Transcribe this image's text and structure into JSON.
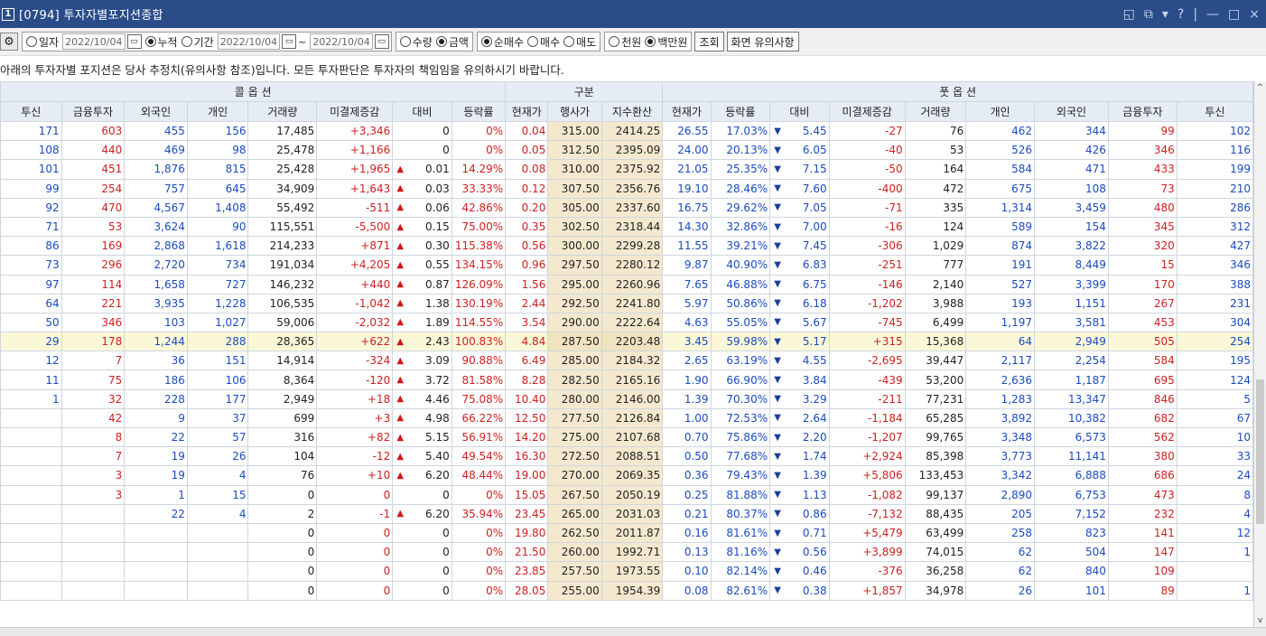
{
  "window": {
    "title_icon": "1",
    "title": "[0794] 투자자별포지션종합",
    "controls": [
      "◱",
      "⧉",
      "▾",
      "?",
      "|",
      "—",
      "□",
      "×"
    ]
  },
  "toolbar": {
    "gear": "⚙",
    "period": {
      "daily": "일자",
      "date1": "2022/10/04",
      "cumulative": "누적",
      "range": "기간",
      "date2": "2022/10/04",
      "tilde": "~",
      "date3": "2022/10/04"
    },
    "unit": {
      "qty": "수량",
      "amount": "금액"
    },
    "trade": {
      "net": "순매수",
      "buy": "매수",
      "sell": "매도"
    },
    "money": {
      "thousand": "천원",
      "million": "백만원"
    },
    "query_button": "조회",
    "notice_button": "화면 유의사항"
  },
  "notice": "아래의 투자자별 포지션은 당사 추정치(유의사항 참조)입니다. 모든 투자판단은 투자자의 책임임을 유의하시기 바랍니다.",
  "header": {
    "call": "콜 옵 션",
    "mid": "구분",
    "put": "풋 옵 션",
    "cols": [
      "투신",
      "금융투자",
      "외국인",
      "개인",
      "거래량",
      "미결제증감",
      "대비",
      "등락률",
      "현재가",
      "행사가",
      "지수환산",
      "현재가",
      "등락률",
      "대비",
      "미결제증감",
      "거래량",
      "개인",
      "외국인",
      "금융투자",
      "투신"
    ]
  },
  "rows": [
    [
      "171",
      "603",
      "455",
      "156",
      "17,485",
      "+3,346",
      "",
      "0",
      "0%",
      "0.04",
      "315.00",
      "2414.25",
      "26.55",
      "17.03%",
      "▼",
      "5.45",
      "-27",
      "76",
      "462",
      "344",
      "99",
      "102"
    ],
    [
      "108",
      "440",
      "469",
      "98",
      "25,478",
      "+1,166",
      "",
      "0",
      "0%",
      "0.05",
      "312.50",
      "2395.09",
      "24.00",
      "20.13%",
      "▼",
      "6.05",
      "-40",
      "53",
      "526",
      "426",
      "346",
      "116"
    ],
    [
      "101",
      "451",
      "1,876",
      "815",
      "25,428",
      "+1,965",
      "▲",
      "0.01",
      "14.29%",
      "0.08",
      "310.00",
      "2375.92",
      "21.05",
      "25.35%",
      "▼",
      "7.15",
      "-50",
      "164",
      "584",
      "471",
      "433",
      "199"
    ],
    [
      "99",
      "254",
      "757",
      "645",
      "34,909",
      "+1,643",
      "▲",
      "0.03",
      "33.33%",
      "0.12",
      "307.50",
      "2356.76",
      "19.10",
      "28.46%",
      "▼",
      "7.60",
      "-400",
      "472",
      "675",
      "108",
      "73",
      "210"
    ],
    [
      "92",
      "470",
      "4,567",
      "1,408",
      "55,492",
      "-511",
      "▲",
      "0.06",
      "42.86%",
      "0.20",
      "305.00",
      "2337.60",
      "16.75",
      "29.62%",
      "▼",
      "7.05",
      "-71",
      "335",
      "1,314",
      "3,459",
      "480",
      "286"
    ],
    [
      "71",
      "53",
      "3,624",
      "90",
      "115,551",
      "-5,500",
      "▲",
      "0.15",
      "75.00%",
      "0.35",
      "302.50",
      "2318.44",
      "14.30",
      "32.86%",
      "▼",
      "7.00",
      "-16",
      "124",
      "589",
      "154",
      "345",
      "312"
    ],
    [
      "86",
      "169",
      "2,868",
      "1,618",
      "214,233",
      "+871",
      "▲",
      "0.30",
      "115.38%",
      "0.56",
      "300.00",
      "2299.28",
      "11.55",
      "39.21%",
      "▼",
      "7.45",
      "-306",
      "1,029",
      "874",
      "3,822",
      "320",
      "427"
    ],
    [
      "73",
      "296",
      "2,720",
      "734",
      "191,034",
      "+4,205",
      "▲",
      "0.55",
      "134.15%",
      "0.96",
      "297.50",
      "2280.12",
      "9.87",
      "40.90%",
      "▼",
      "6.83",
      "-251",
      "777",
      "191",
      "8,449",
      "15",
      "346"
    ],
    [
      "97",
      "114",
      "1,658",
      "727",
      "146,232",
      "+440",
      "▲",
      "0.87",
      "126.09%",
      "1.56",
      "295.00",
      "2260.96",
      "7.65",
      "46.88%",
      "▼",
      "6.75",
      "-146",
      "2,140",
      "527",
      "3,399",
      "170",
      "388"
    ],
    [
      "64",
      "221",
      "3,935",
      "1,228",
      "106,535",
      "-1,042",
      "▲",
      "1.38",
      "130.19%",
      "2.44",
      "292.50",
      "2241.80",
      "5.97",
      "50.86%",
      "▼",
      "6.18",
      "-1,202",
      "3,988",
      "193",
      "1,151",
      "267",
      "231"
    ],
    [
      "50",
      "346",
      "103",
      "1,027",
      "59,006",
      "-2,032",
      "▲",
      "1.89",
      "114.55%",
      "3.54",
      "290.00",
      "2222.64",
      "4.63",
      "55.05%",
      "▼",
      "5.67",
      "-745",
      "6,499",
      "1,197",
      "3,581",
      "453",
      "304"
    ],
    [
      "29",
      "178",
      "1,244",
      "288",
      "28,365",
      "+622",
      "▲",
      "2.43",
      "100.83%",
      "4.84",
      "287.50",
      "2203.48",
      "3.45",
      "59.98%",
      "▼",
      "5.17",
      "+315",
      "15,368",
      "64",
      "2,949",
      "505",
      "254"
    ],
    [
      "12",
      "7",
      "36",
      "151",
      "14,914",
      "-324",
      "▲",
      "3.09",
      "90.88%",
      "6.49",
      "285.00",
      "2184.32",
      "2.65",
      "63.19%",
      "▼",
      "4.55",
      "-2,695",
      "39,447",
      "2,117",
      "2,254",
      "584",
      "195"
    ],
    [
      "11",
      "75",
      "186",
      "106",
      "8,364",
      "-120",
      "▲",
      "3.72",
      "81.58%",
      "8.28",
      "282.50",
      "2165.16",
      "1.90",
      "66.90%",
      "▼",
      "3.84",
      "-439",
      "53,200",
      "2,636",
      "1,187",
      "695",
      "124"
    ],
    [
      "1",
      "32",
      "228",
      "177",
      "2,949",
      "+18",
      "▲",
      "4.46",
      "75.08%",
      "10.40",
      "280.00",
      "2146.00",
      "1.39",
      "70.30%",
      "▼",
      "3.29",
      "-211",
      "77,231",
      "1,283",
      "13,347",
      "846",
      "5"
    ],
    [
      "",
      "42",
      "9",
      "37",
      "699",
      "+3",
      "▲",
      "4.98",
      "66.22%",
      "12.50",
      "277.50",
      "2126.84",
      "1.00",
      "72.53%",
      "▼",
      "2.64",
      "-1,184",
      "65,285",
      "3,892",
      "10,382",
      "682",
      "67"
    ],
    [
      "",
      "8",
      "22",
      "57",
      "316",
      "+82",
      "▲",
      "5.15",
      "56.91%",
      "14.20",
      "275.00",
      "2107.68",
      "0.70",
      "75.86%",
      "▼",
      "2.20",
      "-1,207",
      "99,765",
      "3,348",
      "6,573",
      "562",
      "10"
    ],
    [
      "",
      "7",
      "19",
      "26",
      "104",
      "-12",
      "▲",
      "5.40",
      "49.54%",
      "16.30",
      "272.50",
      "2088.51",
      "0.50",
      "77.68%",
      "▼",
      "1.74",
      "+2,924",
      "85,398",
      "3,773",
      "11,141",
      "380",
      "33"
    ],
    [
      "",
      "3",
      "19",
      "4",
      "76",
      "+10",
      "▲",
      "6.20",
      "48.44%",
      "19.00",
      "270.00",
      "2069.35",
      "0.36",
      "79.43%",
      "▼",
      "1.39",
      "+5,806",
      "133,453",
      "3,342",
      "6,888",
      "686",
      "24"
    ],
    [
      "",
      "3",
      "1",
      "15",
      "0",
      "0",
      "",
      "0",
      "0%",
      "15.05",
      "267.50",
      "2050.19",
      "0.25",
      "81.88%",
      "▼",
      "1.13",
      "-1,082",
      "99,137",
      "2,890",
      "6,753",
      "473",
      "8"
    ],
    [
      "",
      "",
      "22",
      "4",
      "2",
      "-1",
      "▲",
      "6.20",
      "35.94%",
      "23.45",
      "265.00",
      "2031.03",
      "0.21",
      "80.37%",
      "▼",
      "0.86",
      "-7,132",
      "88,435",
      "205",
      "7,152",
      "232",
      "4"
    ],
    [
      "",
      "",
      "",
      "",
      "0",
      "0",
      "",
      "0",
      "0%",
      "19.80",
      "262.50",
      "2011.87",
      "0.16",
      "81.61%",
      "▼",
      "0.71",
      "+5,479",
      "63,499",
      "258",
      "823",
      "141",
      "12"
    ],
    [
      "",
      "",
      "",
      "",
      "0",
      "0",
      "",
      "0",
      "0%",
      "21.50",
      "260.00",
      "1992.71",
      "0.13",
      "81.16%",
      "▼",
      "0.56",
      "+3,899",
      "74,015",
      "62",
      "504",
      "147",
      "1"
    ],
    [
      "",
      "",
      "",
      "",
      "0",
      "0",
      "",
      "0",
      "0%",
      "23.85",
      "257.50",
      "1973.55",
      "0.10",
      "82.14%",
      "▼",
      "0.46",
      "-376",
      "36,258",
      "62",
      "840",
      "109",
      ""
    ],
    [
      "",
      "",
      "",
      "",
      "0",
      "0",
      "",
      "0",
      "0%",
      "28.05",
      "255.00",
      "1954.39",
      "0.08",
      "82.61%",
      "▼",
      "0.38",
      "+1,857",
      "34,978",
      "26",
      "101",
      "89",
      "1"
    ]
  ],
  "highlight_row": 11,
  "scroll": {
    "up": "^",
    "down": "v"
  },
  "colors": {
    "title_bar": "#2a4d8a",
    "header_bg": "#e6ecf5",
    "mid_bg": "#f4e9cf",
    "call_blue": "#1a4bbf",
    "red": "#cf2020",
    "highlight": "#fbf8d8"
  }
}
